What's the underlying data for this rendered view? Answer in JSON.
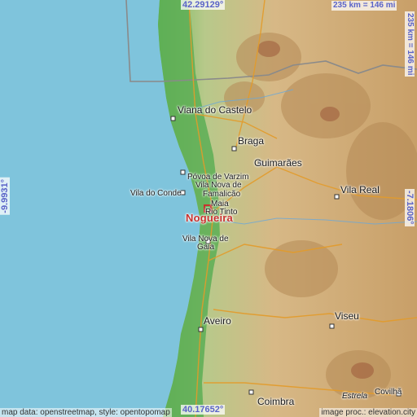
{
  "map": {
    "coords": {
      "top": "42.29129°",
      "bottom": "40.17652°",
      "left": "-9.9931°",
      "right": "-7.1806°",
      "scale_h": "235 km = 146 mi",
      "scale_v": "235 km = 146 mi"
    },
    "highlight": {
      "name": "Nogueira"
    },
    "places": {
      "viana": "Viana do Castelo",
      "braga": "Braga",
      "guimaraes": "Guimarães",
      "povoa": "Póvoa de Varzim",
      "vnf_1": "Vila Nova de",
      "vnf_2": "Famalicão",
      "vila_conde": "Vila do Conde",
      "maia": "Maia",
      "rio_tinto": "Rio Tinto",
      "vila_real": "Vila Real",
      "gaia_1": "Vila Nova de",
      "gaia_2": "Gaia",
      "aveiro": "Aveiro",
      "viseu": "Viseu",
      "coimbra": "Coimbra",
      "covilha": "Covilhã",
      "estrela": "Estrela"
    },
    "credits": {
      "left": "map data: openstreetmap, style: opentopomap",
      "right": "image proc.: elevation.city"
    },
    "colors": {
      "sea": "#7fc4dc",
      "lowland": "#5cae55",
      "highland": "#c9a06a",
      "highlight": "#c8322e",
      "coord_text": "#5a63c8"
    }
  }
}
